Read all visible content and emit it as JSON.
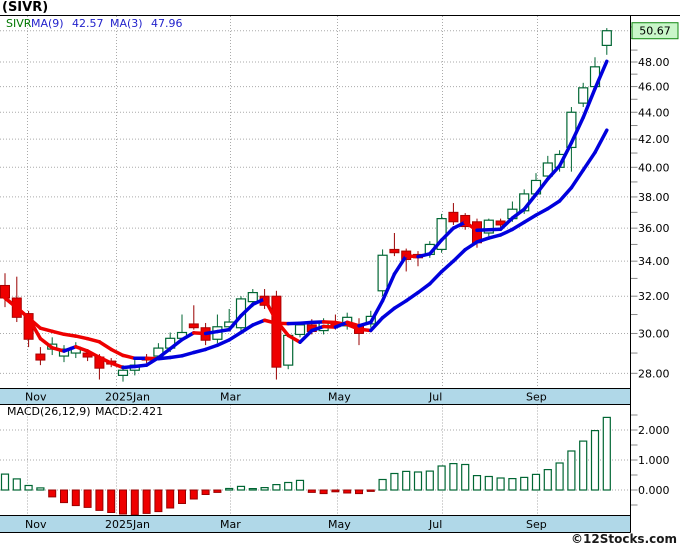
{
  "header": {
    "title": "(SIVR)"
  },
  "legend": {
    "symbol": "SIVR",
    "ma9_label": "MA(9)",
    "ma9_value": "42.57",
    "ma3_label": "MA(3)",
    "ma3_value": "47.96"
  },
  "macd": {
    "params_label": "MACD(26,12,9)",
    "value_label": "MACD:2.421"
  },
  "watermark": "©12Stocks.com",
  "colors": {
    "up_green": "#006633",
    "down_red": "#ee0000",
    "down_red_wick": "#990000",
    "ma_up": "#0000dd",
    "ma_down": "#ee0000",
    "strip_blue": "#b0d8e8",
    "grid": "#aaaaaa",
    "tick": "#888888",
    "price_box_bg": "#c9f6c9",
    "price_box_border": "#118811",
    "axis_text": "#000000"
  },
  "chart_data": [
    {
      "type": "candlestick",
      "title": "SIVR weekly price",
      "scale": "log",
      "ylim": [
        27.3,
        52.0
      ],
      "y_tick_labels": [
        28,
        30,
        32,
        34,
        36,
        38,
        40,
        42,
        44,
        46,
        48
      ],
      "minor_tick_range": [
        28,
        51
      ],
      "last_price": 50.67,
      "x_labels": [
        "Nov",
        "2025Jan",
        "Mar",
        "May",
        "Jul",
        "Sep"
      ],
      "x_label_pos": [
        25,
        105,
        220,
        328,
        429,
        526
      ],
      "grid_x": [
        27,
        116,
        230,
        337,
        442,
        537
      ],
      "ma_windows": [
        9,
        3
      ],
      "candles": [
        [
          32.6,
          33.3,
          31.4,
          31.9
        ],
        [
          31.9,
          33.1,
          30.6,
          30.85
        ],
        [
          31.05,
          31.2,
          29.3,
          29.7
        ],
        [
          28.95,
          29.3,
          28.4,
          28.65
        ],
        [
          29.2,
          29.8,
          28.9,
          29.45
        ],
        [
          28.85,
          29.4,
          28.55,
          29.2
        ],
        [
          29.0,
          29.55,
          28.75,
          29.3
        ],
        [
          29.0,
          29.2,
          28.6,
          28.8
        ],
        [
          28.8,
          28.95,
          27.7,
          28.25
        ],
        [
          28.6,
          28.75,
          28.3,
          28.45
        ],
        [
          27.9,
          28.4,
          27.6,
          28.15
        ],
        [
          28.15,
          28.65,
          27.9,
          28.4
        ],
        [
          28.75,
          28.95,
          28.5,
          28.65
        ],
        [
          28.85,
          29.5,
          28.7,
          29.25
        ],
        [
          29.25,
          30.05,
          29.05,
          29.75
        ],
        [
          29.75,
          31.0,
          29.6,
          30.05
        ],
        [
          30.5,
          31.5,
          30.2,
          30.3
        ],
        [
          30.3,
          30.55,
          29.4,
          29.65
        ],
        [
          29.7,
          31.0,
          29.5,
          30.35
        ],
        [
          30.35,
          31.3,
          30.1,
          30.6
        ],
        [
          30.3,
          32.0,
          30.1,
          31.85
        ],
        [
          31.7,
          32.4,
          31.4,
          32.2
        ],
        [
          32.0,
          32.4,
          31.3,
          31.5
        ],
        [
          32.0,
          32.3,
          27.7,
          28.3
        ],
        [
          28.4,
          30.0,
          28.2,
          29.9
        ],
        [
          29.95,
          30.6,
          29.8,
          30.45
        ],
        [
          30.45,
          30.75,
          29.95,
          30.1
        ],
        [
          30.15,
          30.8,
          29.95,
          30.55
        ],
        [
          30.55,
          31.0,
          30.2,
          30.35
        ],
        [
          30.4,
          31.1,
          30.2,
          30.85
        ],
        [
          30.45,
          30.8,
          29.4,
          30.0
        ],
        [
          30.5,
          31.2,
          30.3,
          30.9
        ],
        [
          32.3,
          34.7,
          32.0,
          34.35
        ],
        [
          34.7,
          35.7,
          34.3,
          34.5
        ],
        [
          34.6,
          34.75,
          33.4,
          34.1
        ],
        [
          34.4,
          34.6,
          33.7,
          34.2
        ],
        [
          34.4,
          35.2,
          34.2,
          35.0
        ],
        [
          34.7,
          36.9,
          34.5,
          36.6
        ],
        [
          37.0,
          37.6,
          36.2,
          36.4
        ],
        [
          36.8,
          36.95,
          35.9,
          36.1
        ],
        [
          36.4,
          36.6,
          34.8,
          35.1
        ],
        [
          35.7,
          36.6,
          35.5,
          36.5
        ],
        [
          36.45,
          36.6,
          36.0,
          36.2
        ],
        [
          36.6,
          37.7,
          36.4,
          37.2
        ],
        [
          37.1,
          38.5,
          36.9,
          38.2
        ],
        [
          38.2,
          39.6,
          38.0,
          39.1
        ],
        [
          39.4,
          40.8,
          39.2,
          40.3
        ],
        [
          40.0,
          41.2,
          39.7,
          40.9
        ],
        [
          41.4,
          44.4,
          39.7,
          44.0
        ],
        [
          44.7,
          46.3,
          44.4,
          45.9
        ],
        [
          46.0,
          48.4,
          45.8,
          47.6
        ],
        [
          49.4,
          50.9,
          48.6,
          50.67
        ]
      ]
    },
    {
      "type": "bar",
      "title": "MACD(26,12,9)",
      "last_value": 2.421,
      "y_tick_labels": [
        "0.000",
        "1.000",
        "2.000"
      ],
      "y_tick_values": [
        0,
        1,
        2
      ],
      "values": [
        0.53,
        0.37,
        0.15,
        0.07,
        -0.23,
        -0.42,
        -0.52,
        -0.58,
        -0.68,
        -0.75,
        -0.8,
        -0.83,
        -0.78,
        -0.72,
        -0.6,
        -0.45,
        -0.3,
        -0.15,
        -0.08,
        0.05,
        0.12,
        0.04,
        0.08,
        0.18,
        0.25,
        0.32,
        -0.08,
        -0.12,
        -0.06,
        -0.1,
        -0.12,
        -0.04,
        0.35,
        0.55,
        0.62,
        0.6,
        0.63,
        0.8,
        0.88,
        0.85,
        0.48,
        0.45,
        0.4,
        0.38,
        0.42,
        0.52,
        0.68,
        0.9,
        1.3,
        1.63,
        1.98,
        2.42
      ]
    }
  ]
}
